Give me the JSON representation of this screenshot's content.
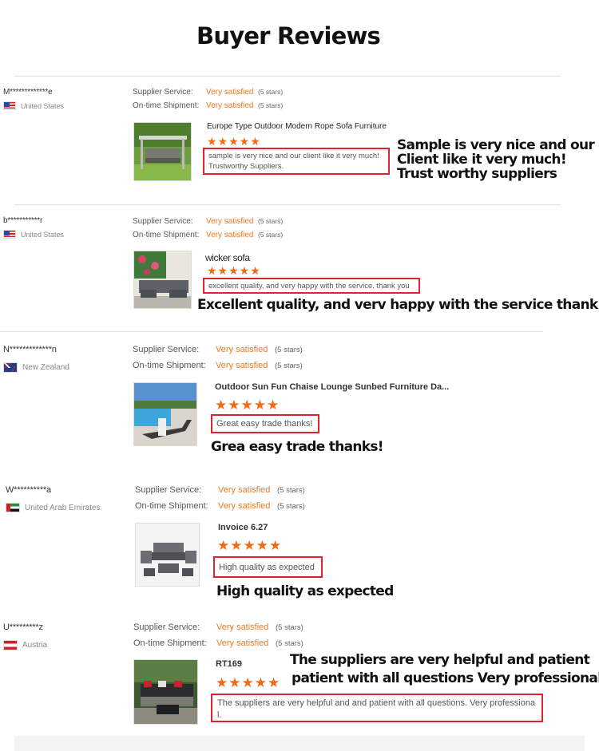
{
  "page_title": "Buyer Reviews",
  "reviews": [
    {
      "buyer": "M*************e",
      "country": "United States",
      "supplier_service_label": "Supplier Service:",
      "supplier_service_value": "Very satisfied",
      "supplier_service_stars": "(5 stars)",
      "shipment_label": "On-time Shipment:",
      "shipment_value": "Very satisfied",
      "shipment_stars": "(5 stars)",
      "product": "Europe Type Outdoor Modern Rope Sofa Furniture",
      "stars": "★★★★★",
      "rating": 5,
      "comment": "sample is very nice and our client like it very much! Trustworthy Suppliers.",
      "translation_lines": [
        "Sample is very nice and our",
        "Client like it very much!",
        "Trust worthy suppliers"
      ]
    },
    {
      "buyer": "b***********r",
      "country": "United States",
      "supplier_service_label": "Supplier Service:",
      "supplier_service_value": "Very satisfied",
      "supplier_service_stars": "(5 stars)",
      "shipment_label": "On-time Shipment:",
      "shipment_value": "Very satisfied",
      "shipment_stars": "(5 stars)",
      "product": "wicker sofa",
      "stars": "★★★★★",
      "rating": 5,
      "comment": "excellent quality, and very happy with the service. thank you",
      "translation_lines": [
        "Excellent quality, and verv happy with the service thank you"
      ]
    },
    {
      "buyer": "N*************n",
      "country": "New Zealand",
      "supplier_service_label": "Supplier Service:",
      "supplier_service_value": "Very satisfied",
      "supplier_service_stars": "(5 stars)",
      "shipment_label": "On-time Shipment:",
      "shipment_value": "Very satisfied",
      "shipment_stars": "(5 stars)",
      "product": "Outdoor Sun Fun Chaise Lounge Sunbed Furniture Da...",
      "stars": "★★★★★",
      "rating": 5,
      "comment": "Great easy trade thanks!",
      "translation_lines": [
        "Grea easy trade thanks!"
      ]
    },
    {
      "buyer": "W**********a",
      "country": "United Arab Emirates",
      "supplier_service_label": "Supplier Service:",
      "supplier_service_value": "Very satisfied",
      "supplier_service_stars": "(5 stars)",
      "shipment_label": "On-time Shipment:",
      "shipment_value": "Very satisfied",
      "shipment_stars": "(5 stars)",
      "product": "Invoice 6.27",
      "stars": "★★★★★",
      "rating": 5,
      "comment": "High quality as expected",
      "translation_lines": [
        "High quality as expected"
      ]
    },
    {
      "buyer": "U*********z",
      "country": "Austria",
      "supplier_service_label": "Supplier Service:",
      "supplier_service_value": "Very satisfied",
      "supplier_service_stars": "(5 stars)",
      "shipment_label": "On-time Shipment:",
      "shipment_value": "Very satisfied",
      "shipment_stars": "(5 stars)",
      "product": "RT169",
      "stars": "★★★★★",
      "rating": 5,
      "comment": "The suppliers are very helpful and and patient with all questions. Very professiona l.",
      "translation_lines": [
        "The suppliers are very helpful and patient",
        "patient with all questions Very professional"
      ]
    }
  ],
  "colors": {
    "accent_orange": "#ee7a1e",
    "star_orange": "#ef6b16",
    "highlight_red": "#e0212e"
  }
}
